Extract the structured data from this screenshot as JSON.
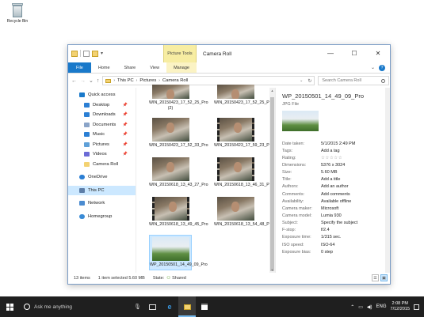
{
  "desktop": {
    "recycle_bin_label": "Recycle Bin"
  },
  "window": {
    "contextual_tab": "Picture Tools",
    "title": "Camera Roll",
    "controls": {
      "minimize": "—",
      "maximize": "☐",
      "close": "✕"
    }
  },
  "ribbon": {
    "tabs": [
      "File",
      "Home",
      "Share",
      "View",
      "Manage"
    ],
    "expand": "⌄",
    "help": "?"
  },
  "address": {
    "back": "←",
    "forward": "→",
    "recent": "⌄",
    "up": "↑",
    "crumbs": [
      "This PC",
      "Pictures",
      "Camera Roll"
    ],
    "separator": "›",
    "dropdown": "⌄",
    "refresh": "↻",
    "search_placeholder": "Search Camera Roll"
  },
  "nav_pane": {
    "pin": "📌",
    "items": [
      {
        "label": "Quick access",
        "color": "#1979ca"
      },
      {
        "label": "Desktop",
        "color": "#2b7fd4"
      },
      {
        "label": "Downloads",
        "color": "#2b7fd4"
      },
      {
        "label": "Documents",
        "color": "#8aa4c8"
      },
      {
        "label": "Music",
        "color": "#2b7fd4"
      },
      {
        "label": "Pictures",
        "color": "#5fa0d8"
      },
      {
        "label": "Videos",
        "color": "#6b6bd6"
      },
      {
        "label": "Camera Roll",
        "color": "#f3d272"
      },
      {
        "label": "OneDrive",
        "color": "#2b7fd4"
      },
      {
        "label": "This PC",
        "color": "#5d7ea8"
      },
      {
        "label": "Network",
        "color": "#4b8bd0"
      },
      {
        "label": "Homegroup",
        "color": "#3a8bd6"
      }
    ]
  },
  "files": [
    {
      "name": "WIN_20150423_17_52_25_Pro (2)"
    },
    {
      "name": "WIN_20150423_17_52_25_Pro"
    },
    {
      "name": "WIN_20150423_17_52_33_Pro"
    },
    {
      "name": "WIN_20150423_17_59_23_Pro"
    },
    {
      "name": "WIN_20150618_13_43_27_Pro"
    },
    {
      "name": "WIN_20150618_13_46_31_Pro"
    },
    {
      "name": "WIN_20150618_13_49_45_Pro"
    },
    {
      "name": "WIN_20150618_13_54_48_Pro"
    },
    {
      "name": "WP_20150501_14_49_09_Pro"
    }
  ],
  "details": {
    "name": "WP_20150501_14_49_09_Pro",
    "type": "JPG File",
    "properties": [
      {
        "key": "Date taken:",
        "value": "5/1/2015 2:49 PM"
      },
      {
        "key": "Tags:",
        "value": "Add a tag"
      },
      {
        "key": "Rating:",
        "value": "☆☆☆☆☆"
      },
      {
        "key": "Dimensions:",
        "value": "5376 x 3024"
      },
      {
        "key": "Size:",
        "value": "5.60 MB"
      },
      {
        "key": "Title:",
        "value": "Add a title"
      },
      {
        "key": "Authors:",
        "value": "Add an author"
      },
      {
        "key": "Comments:",
        "value": "Add comments"
      },
      {
        "key": "Availability:",
        "value": "Available offline"
      },
      {
        "key": "Camera maker:",
        "value": "Microsoft"
      },
      {
        "key": "Camera model:",
        "value": "Lumia 930"
      },
      {
        "key": "Subject:",
        "value": "Specify the subject"
      },
      {
        "key": "F-stop:",
        "value": "f/2.4"
      },
      {
        "key": "Exposure time:",
        "value": "1/315 sec."
      },
      {
        "key": "ISO speed:",
        "value": "ISO-64"
      },
      {
        "key": "Exposure bias:",
        "value": "0 step"
      }
    ]
  },
  "status": {
    "count": "13 items",
    "selected": "1 item selected  5.60 MB",
    "state": "State:",
    "state_value": "Shared"
  },
  "taskbar": {
    "search_text": "Ask me anything",
    "language": "ENG",
    "time": "2:08 PM",
    "date": "7/12/2015"
  }
}
